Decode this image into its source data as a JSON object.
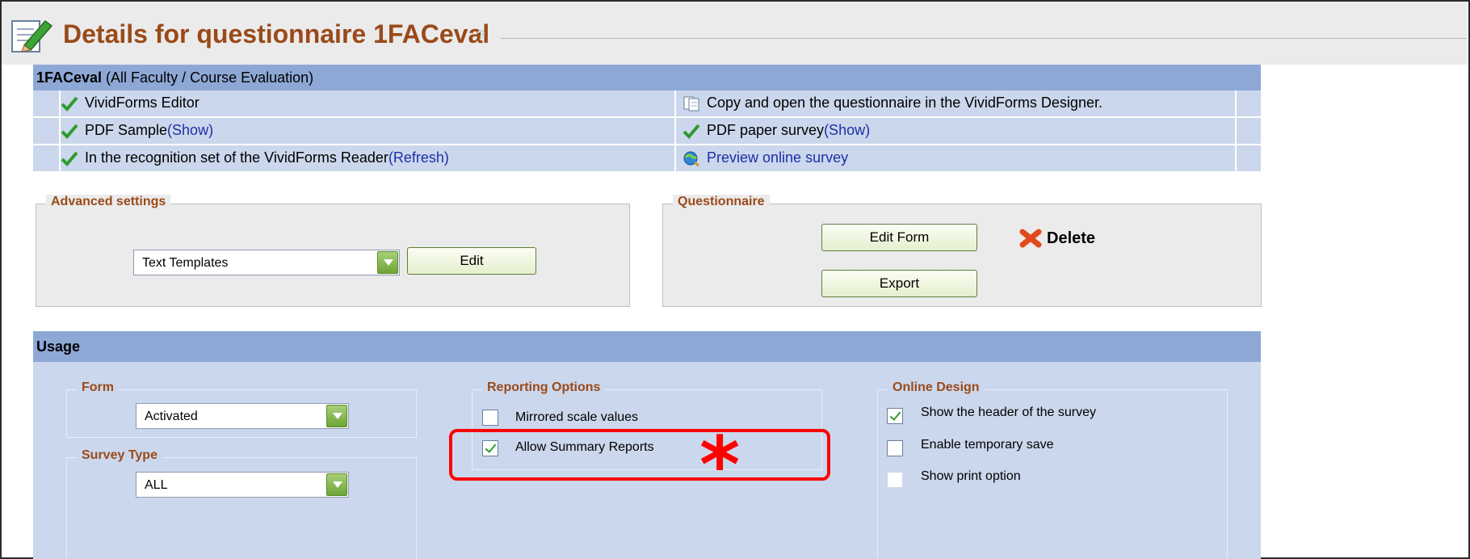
{
  "title": {
    "text": "Details for questionnaire 1FACeval",
    "help": "?"
  },
  "details": {
    "header_bold": "1FACeval",
    "header_rest": " (All Faculty / Course Evaluation)",
    "rows": [
      {
        "left": {
          "text": "VividForms Editor",
          "link": "",
          "icon": "check-icon"
        },
        "right": {
          "text": "Copy and open the questionnaire in the VividForms Designer.",
          "link": "",
          "icon": "copy-icon"
        }
      },
      {
        "left": {
          "text": "PDF Sample ",
          "link": "(Show)",
          "icon": "check-icon"
        },
        "right": {
          "text": "PDF paper survey ",
          "link": "(Show)",
          "icon": "check-icon"
        }
      },
      {
        "left": {
          "text": "In the recognition set of the VividForms Reader ",
          "link": "(Refresh)",
          "icon": "check-icon"
        },
        "right": {
          "text": "",
          "link": "Preview online survey",
          "icon": "preview-icon"
        }
      }
    ]
  },
  "advanced": {
    "legend": "Advanced settings",
    "select_value": "Text Templates",
    "edit_label": "Edit"
  },
  "questionnaire": {
    "legend": "Questionnaire",
    "edit_form_label": "Edit Form",
    "delete_label": "Delete",
    "export_label": "Export"
  },
  "usage": {
    "title": "Usage",
    "form": {
      "legend": "Form",
      "select_value": "Activated"
    },
    "survey_type": {
      "legend": "Survey Type",
      "select_value": "ALL"
    },
    "reporting": {
      "legend": "Reporting Options",
      "options": [
        {
          "label": "Mirrored scale values",
          "checked": false
        },
        {
          "label": "Allow Summary Reports",
          "checked": true
        }
      ]
    },
    "online_design": {
      "legend": "Online Design",
      "options": [
        {
          "label": "Show the header of the survey",
          "checked": true
        },
        {
          "label": "Enable temporary save",
          "checked": false
        },
        {
          "label": "Show print option",
          "checked": false
        }
      ]
    }
  },
  "annotation": {
    "asterisk": "*",
    "color": "#ff0000"
  },
  "colors": {
    "accent_title": "#9a4a1a",
    "header_blue": "#8ea8d6",
    "row_blue": "#cbd7ec",
    "link": "#1c2fa8"
  }
}
